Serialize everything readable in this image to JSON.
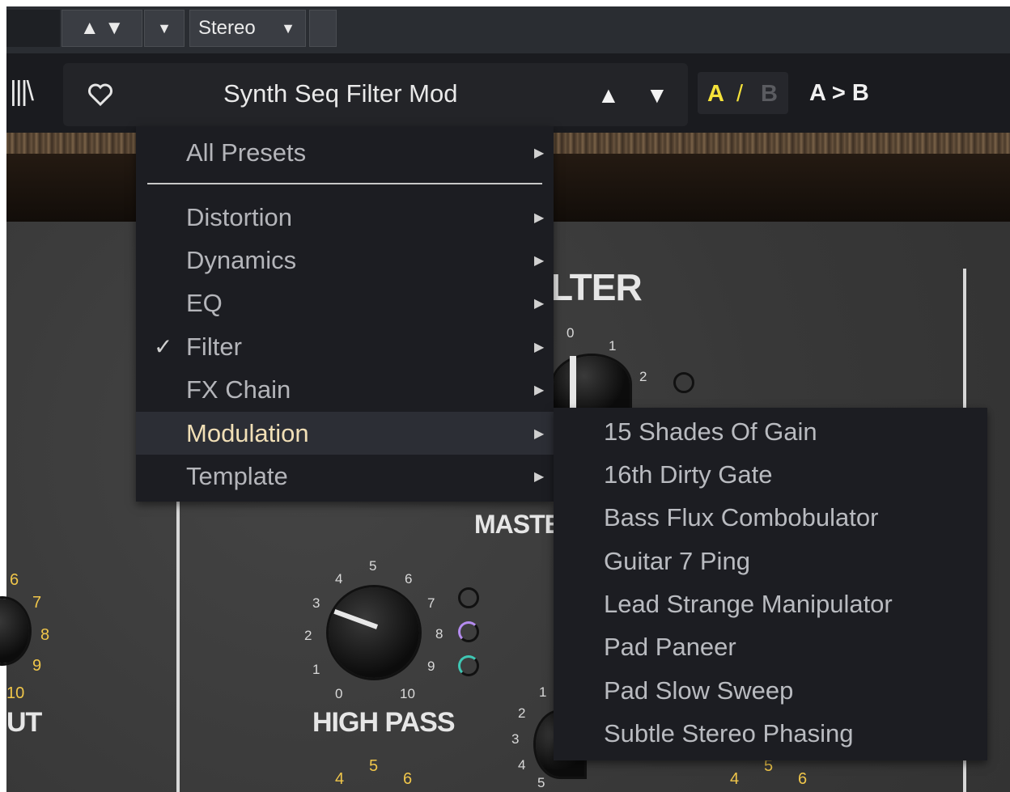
{
  "daw": {
    "updown_icons": "▲ ▼",
    "dropdown_glyph": "▼",
    "channel_mode": "Stereo"
  },
  "topbar": {
    "library_icon": "|||\\",
    "preset_name": "Synth Seq Filter Mod",
    "prev_glyph": "▲",
    "next_glyph": "▼",
    "slot_a": "A",
    "slot_sep": "/",
    "slot_b": "B",
    "copy_ab": "A > B"
  },
  "menu": {
    "items": [
      {
        "label": "All Presets",
        "checked": false
      },
      {
        "label": "Distortion",
        "checked": false
      },
      {
        "label": "Dynamics",
        "checked": false
      },
      {
        "label": "EQ",
        "checked": false
      },
      {
        "label": "Filter",
        "checked": true
      },
      {
        "label": "FX Chain",
        "checked": false
      },
      {
        "label": "Modulation",
        "checked": false,
        "highlighted": true
      },
      {
        "label": "Template",
        "checked": false
      }
    ],
    "check_glyph": "✓",
    "arrow_glyph": "▶"
  },
  "submenu": {
    "items": [
      "15 Shades Of Gain",
      "16th Dirty Gate",
      "Bass Flux Combobulator",
      "Guitar 7 Ping",
      "Lead Strange Manipulator",
      "Pad Paneer",
      "Pad Slow Sweep",
      "Subtle Stereo Phasing"
    ]
  },
  "panel": {
    "filter_title_partial": "LTER",
    "master_partial": "MASTE",
    "high_pass_label": "HIGH PASS",
    "out_label_partial": "UT",
    "hp_ticks": [
      "0",
      "1",
      "2",
      "3",
      "4",
      "5",
      "6",
      "7",
      "8",
      "9",
      "10"
    ],
    "left_ticks": [
      "6",
      "7",
      "8",
      "9",
      "10"
    ],
    "filter_ticks": [
      "0",
      "1",
      "2"
    ],
    "master_ticks": [
      "1",
      "2",
      "3",
      "4",
      "5",
      "4"
    ],
    "bottom_ticks": [
      "4",
      "5",
      "6"
    ]
  },
  "colors": {
    "accent_a": "#f5e23a",
    "menu_bg": "#1c1d22",
    "highlight_text": "#f1dfb6"
  }
}
